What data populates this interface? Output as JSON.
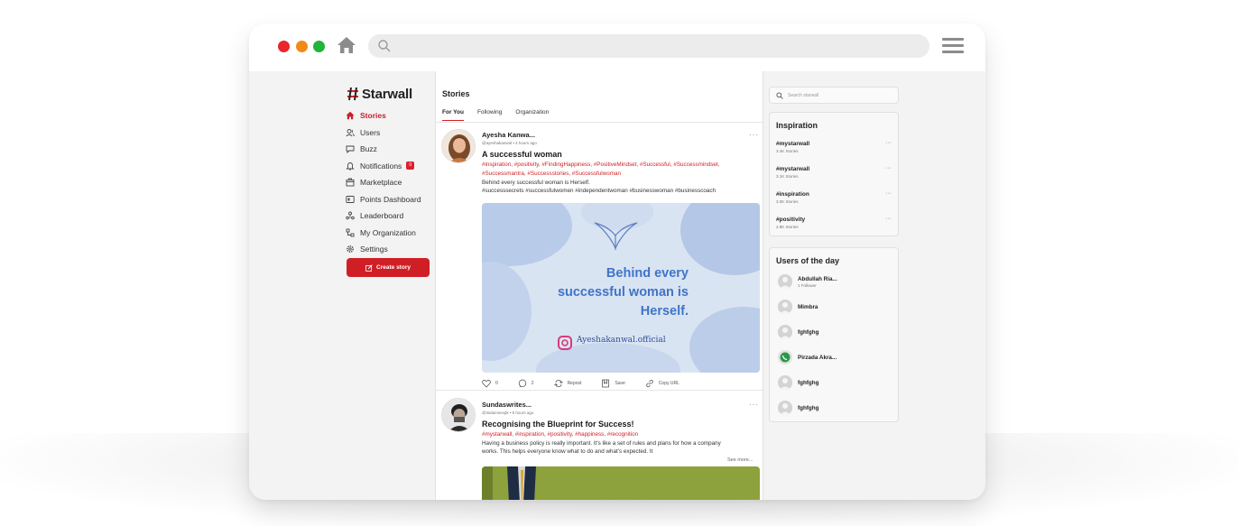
{
  "browser": {
    "url": ""
  },
  "brand": {
    "name": "Starwall",
    "tagline": ""
  },
  "nav": {
    "items": [
      {
        "label": "Stories",
        "icon": "home-icon",
        "active": true
      },
      {
        "label": "Users",
        "icon": "users-icon"
      },
      {
        "label": "Buzz",
        "icon": "chat-icon"
      },
      {
        "label": "Notifications",
        "icon": "bell-icon",
        "badge": "0"
      },
      {
        "label": "Marketplace",
        "icon": "store-icon"
      },
      {
        "label": "Points Dashboard",
        "icon": "dashboard-icon"
      },
      {
        "label": "Leaderboard",
        "icon": "leaderboard-icon"
      },
      {
        "label": "My Organization",
        "icon": "org-icon"
      },
      {
        "label": "Settings",
        "icon": "gear-icon"
      }
    ],
    "create_label": "Create story"
  },
  "feed": {
    "title": "Stories",
    "tabs": [
      "For You",
      "Following",
      "Organization"
    ],
    "active_tab": "For You",
    "posts": [
      {
        "author": "Ayesha Kanwa...",
        "handle": "@ayeshakanwal",
        "time": "4 hours ago",
        "title": "A successful woman",
        "tags": "#inspiration, #positivity, #FindingHappiness, #PositiveMindset, #Successful, #Successmindset, #Successmantra, #Successstories, #Successfulwoman",
        "body_line1": "Behind every successful woman is Herself.",
        "body_line2": "#successsecrets #successfulwomen #independentwoman #businesswoman #businesscoach",
        "image_text_line1": "Behind every",
        "image_text_line2": "successful woman is",
        "image_text_line3": "Herself.",
        "image_handle": "Ayeshakanwal.official",
        "likes": "0",
        "comments": "2",
        "repost_label": "Repost",
        "save_label": "Save",
        "copy_label": "Copy URL"
      },
      {
        "author": "Sundaswrites...",
        "handle": "@itsdamsexpk",
        "time": "5 hours ago",
        "title": "Recognising the Blueprint for Success!",
        "tags": "#mystarwall, #inspiration, #positivity, #happiness, #recognition",
        "body_line1": "Having a business policy is really important. It's like a set of rules and plans for how a company",
        "body_line2": "works. This helps everyone know what to do and what's expected. It",
        "see_more": "See more..."
      }
    ]
  },
  "right": {
    "search_placeholder": "Search starwall",
    "inspiration": {
      "title": "Inspiration",
      "items": [
        {
          "tag": "#mystarwall",
          "count": "3.4K Stories"
        },
        {
          "tag": "#mystarwall",
          "count": "3.1K Stories"
        },
        {
          "tag": "#inspiration",
          "count": "3.0K Stories"
        },
        {
          "tag": "#positivity",
          "count": "2.8K Stories"
        }
      ]
    },
    "users_of_day": {
      "title": "Users of the day",
      "users": [
        {
          "name": "Abdullah Ria...",
          "sub": "1 Follower"
        },
        {
          "name": "Mimbra",
          "sub": ""
        },
        {
          "name": "fghfghg",
          "sub": ""
        },
        {
          "name": "Pirzada Akra...",
          "sub": ""
        },
        {
          "name": "fghfghg",
          "sub": ""
        },
        {
          "name": "fghfghg",
          "sub": ""
        }
      ]
    }
  },
  "colors": {
    "accent": "#cf1f25",
    "window_red": "#e8262c",
    "window_orange": "#f28a1a",
    "window_green": "#22b33a"
  }
}
